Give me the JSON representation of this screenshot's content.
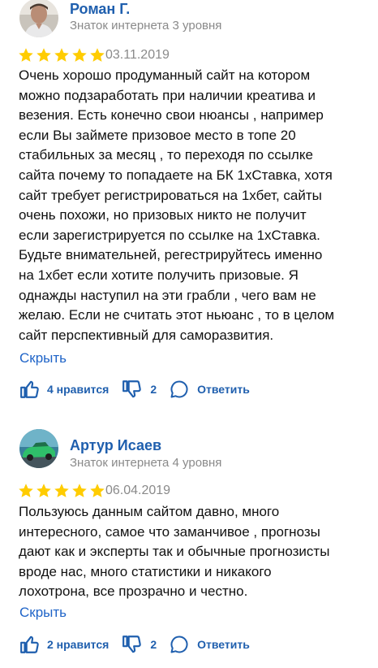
{
  "reviews": [
    {
      "author": "Роман Г.",
      "level": "Знаток интернета 3 уровня",
      "rating": 5,
      "date": "03.11.2019",
      "text_lines": [
        "Очень хорошо продуманный сайт на котором",
        "можно подзаработать при наличии креатива и",
        "везения. Есть конечно свои нюансы , например",
        "если Вы займете призовое место в топе 20",
        "стабильных за месяц , то переходя по ссылке",
        "сайта почему то попадаете на БК 1хСтавка, хотя",
        "сайт требует регистрироваться на 1хбет, сайты",
        "очень похожи, но призовых никто не получит",
        "если зарегистрируется по ссылке на 1хСтавка.",
        "Будьте внимательней, регестрируйтесь именно",
        "на 1хбет если хотите получить призовые. Я",
        "однажды наступил на эти грабли , чего вам не",
        "желаю. Если не считать этот ньюанс , то в целом",
        "сайт перспективный для саморазвития."
      ],
      "hide_label": "Скрыть",
      "likes_label": "4 нравится",
      "dislikes": "2",
      "reply_label": "Ответить",
      "avatar_icon": "person-photo-avatar"
    },
    {
      "author": "Артур Исаев",
      "level": "Знаток интернета 4 уровня",
      "rating": 5,
      "date": "06.04.2019",
      "text_lines": [
        "Пользуюсь данным сайтом давно, много",
        "интересного, самое что заманчивое , прогнозы",
        "дают как и эксперты так и обычные прогнозисты",
        "вроде нас, много статистики и никакого",
        "лохотрона, все прозрачно и честно."
      ],
      "hide_label": "Скрыть",
      "likes_label": "2 нравится",
      "dislikes": "2",
      "reply_label": "Ответить",
      "avatar_icon": "green-car-avatar"
    }
  ],
  "colors": {
    "author": "#1f5fae",
    "link": "#1f64c8",
    "star": "#ffcc00",
    "muted": "#8a8a8a"
  }
}
